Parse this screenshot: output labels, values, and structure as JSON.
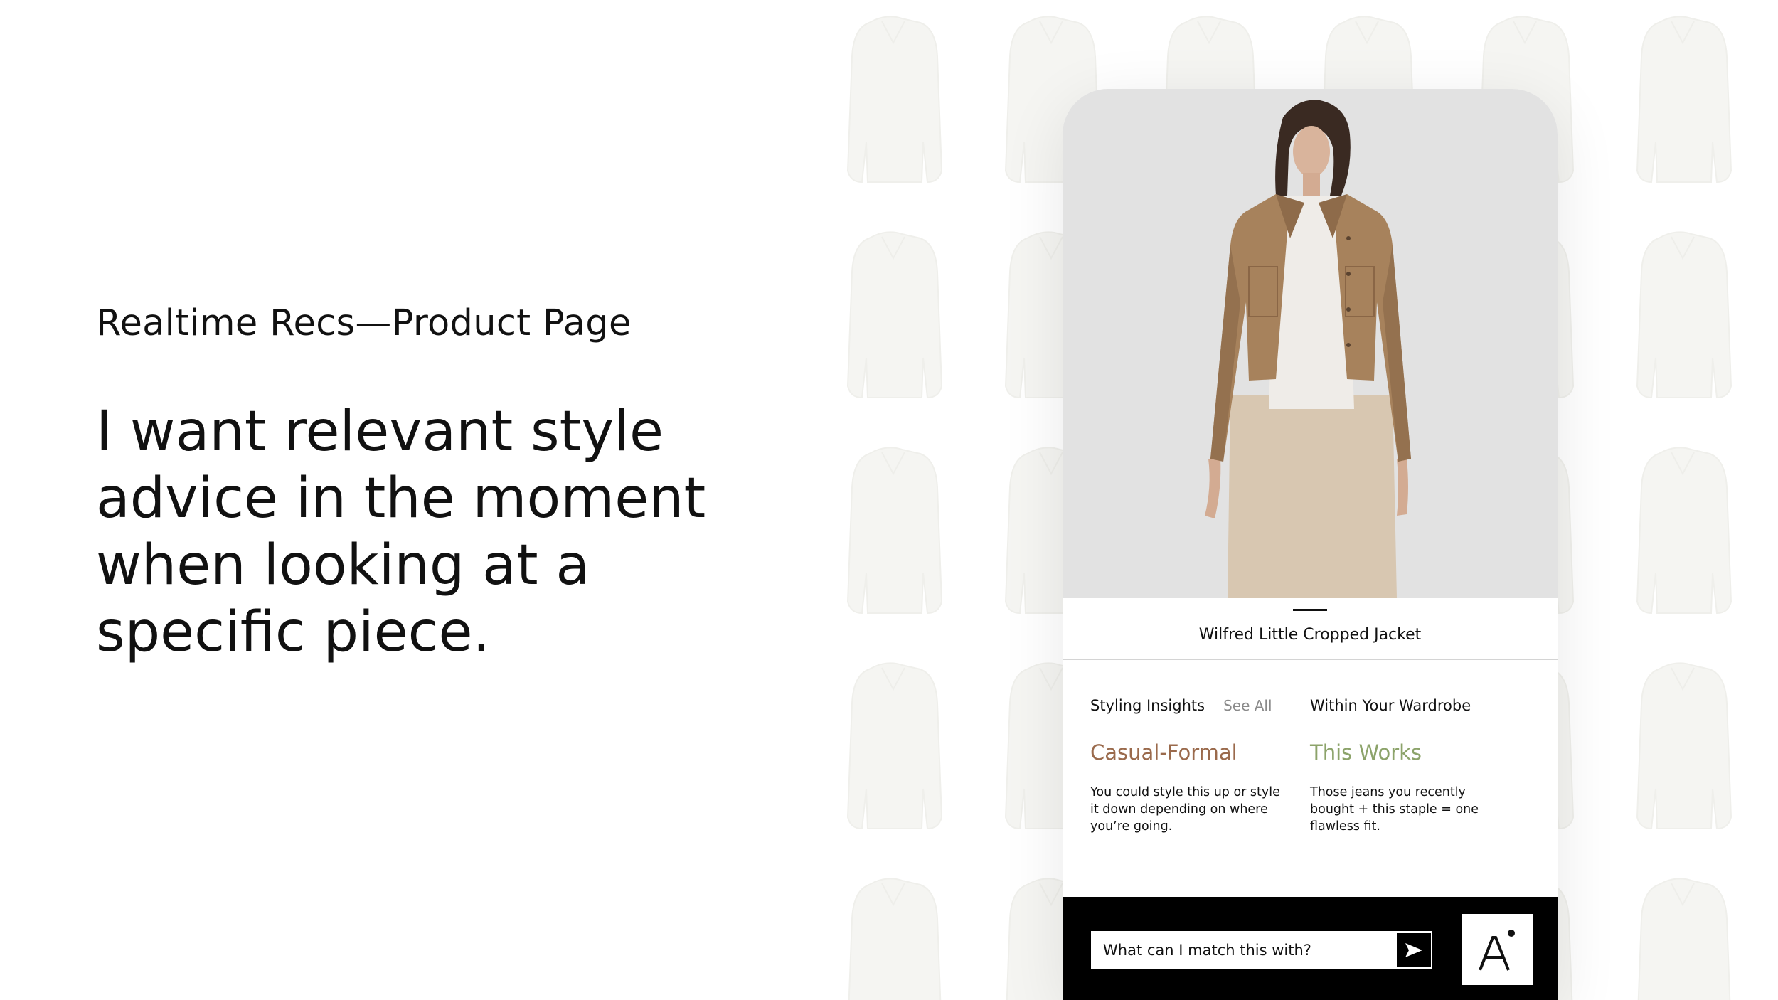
{
  "eyebrow": "Realtime Recs—Product Page",
  "headline": "I want relevant style advice in the moment when looking at a specific piece.",
  "product": {
    "name": "Wilfred Little Cropped Jacket"
  },
  "insights": {
    "styling": {
      "heading": "Styling Insights",
      "see_all": "See All",
      "title": "Casual-Formal",
      "title_color": "#9a6a4c",
      "body": "You could style this up or style it down depending on where you’re going."
    },
    "wardrobe": {
      "heading": "Within Your Wardrobe",
      "title": "This Works",
      "title_color": "#8ca36a",
      "body": "Those jeans you recently bought + this staple = one flawless fit."
    }
  },
  "chat": {
    "placeholder": "What can I match this with?",
    "send_icon": "send-arrow-icon"
  },
  "brand": {
    "logo_letter": "A"
  },
  "colors": {
    "jacket": "#a7825c",
    "skirt": "#d8c7b1",
    "hero_bg": "#e2e2e2",
    "pattern": "#f6f6f4"
  }
}
